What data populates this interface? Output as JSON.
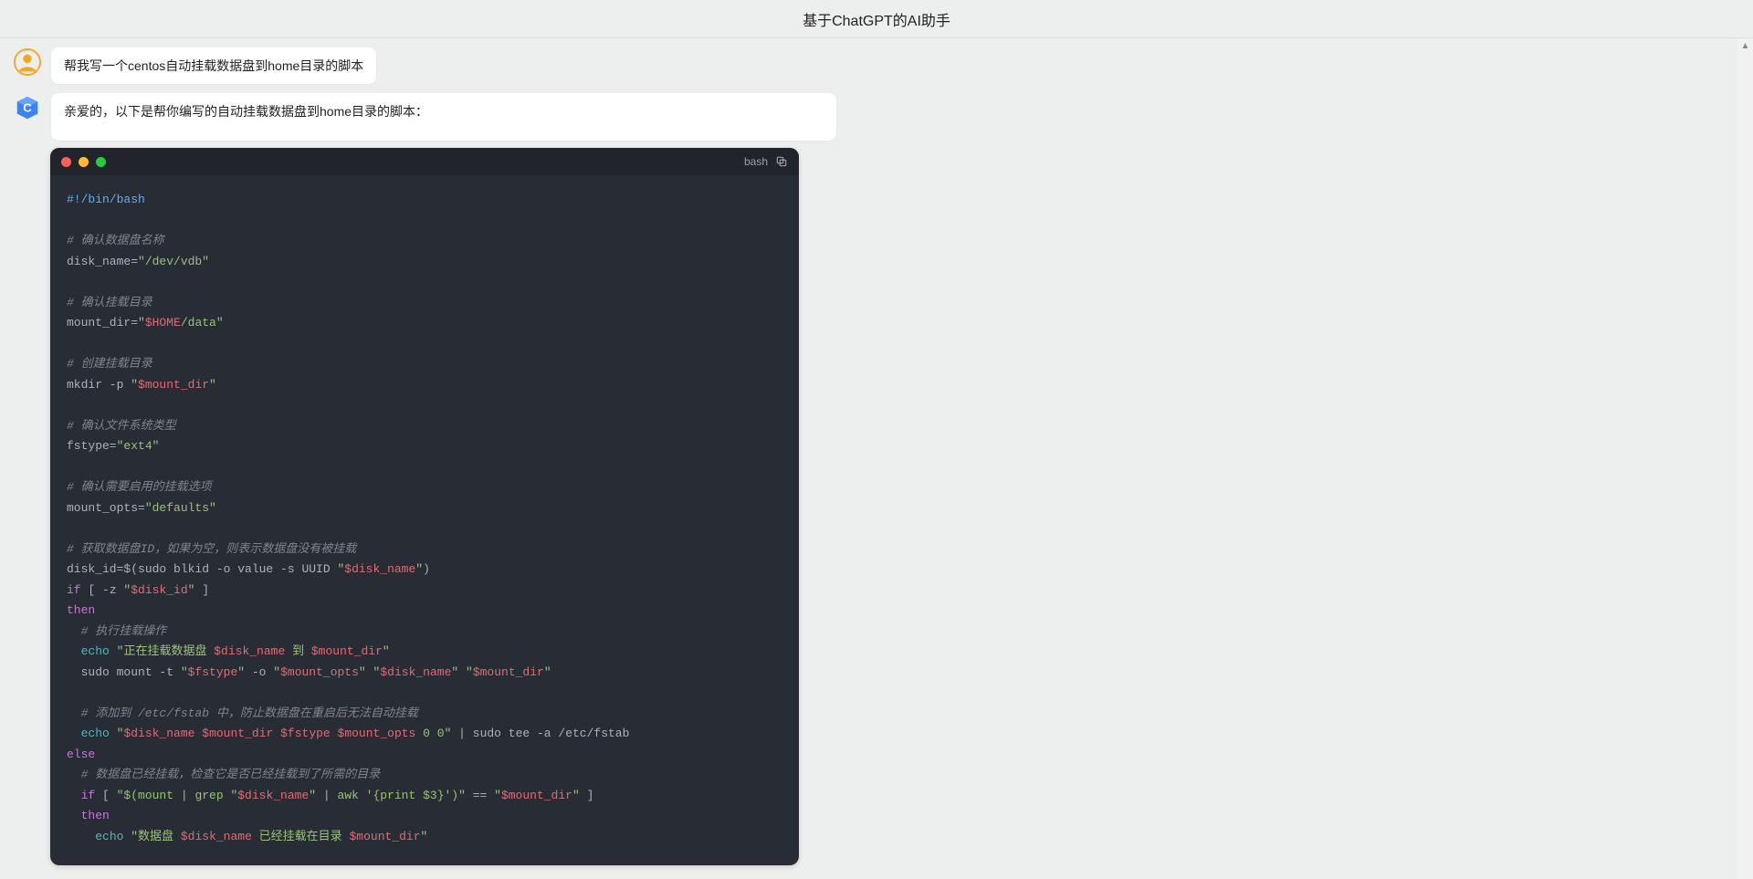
{
  "header": {
    "title": "基于ChatGPT的AI助手"
  },
  "conversation": {
    "user_message": "帮我写一个centos自动挂载数据盘到home目录的脚本",
    "bot_intro": "亲爱的，以下是帮你编写的自动挂载数据盘到home目录的脚本：",
    "code_language_label": "bash",
    "code": {
      "shebang": "#!/bin/bash",
      "c1": "# 确认数据盘名称",
      "l1a": "disk_name=",
      "l1b": "\"/dev/vdb\"",
      "c2": "# 确认挂载目录",
      "l2a": "mount_dir=",
      "l2b": "\"",
      "l2c": "$HOME",
      "l2d": "/data\"",
      "c3": "# 创建挂载目录",
      "l3a": "mkdir -p ",
      "l3b": "\"",
      "l3c": "$mount_dir",
      "l3d": "\"",
      "c4": "# 确认文件系统类型",
      "l4a": "fstype=",
      "l4b": "\"ext4\"",
      "c5": "# 确认需要启用的挂载选项",
      "l5a": "mount_opts=",
      "l5b": "\"defaults\"",
      "c6": "# 获取数据盘ID，如果为空，则表示数据盘没有被挂载",
      "l6a": "disk_id=$(sudo blkid -o value -s UUID ",
      "l6b": "\"",
      "l6c": "$disk_name",
      "l6d": "\"",
      "l6e": ")",
      "l7a": "if",
      "l7b": " [ -z ",
      "l7c": "\"",
      "l7d": "$disk_id",
      "l7e": "\"",
      "l7f": " ]",
      "l8": "then",
      "c7": "  # 执行挂载操作",
      "l9a": "  ",
      "l9b": "echo",
      "l9c": " ",
      "l9d": "\"正在挂载数据盘 ",
      "l9e": "$disk_name",
      "l9f": " 到 ",
      "l9g": "$mount_dir",
      "l9h": "\"",
      "l10a": "  sudo mount -t ",
      "l10b": "\"",
      "l10c": "$fstype",
      "l10d": "\"",
      "l10e": " -o ",
      "l10f": "\"",
      "l10g": "$mount_opts",
      "l10h": "\"",
      "l10i": " ",
      "l10j": "\"",
      "l10k": "$disk_name",
      "l10l": "\"",
      "l10m": " ",
      "l10n": "\"",
      "l10o": "$mount_dir",
      "l10p": "\"",
      "c8": "  # 添加到 /etc/fstab 中，防止数据盘在重启后无法自动挂载",
      "l11a": "  ",
      "l11b": "echo",
      "l11c": " ",
      "l11d": "\"",
      "l11e": "$disk_name",
      "l11f": " ",
      "l11g": "$mount_dir",
      "l11h": " ",
      "l11i": "$fstype",
      "l11j": " ",
      "l11k": "$mount_opts",
      "l11l": " 0 0\"",
      "l11m": " | sudo tee -a /etc/fstab",
      "l12": "else",
      "c9": "  # 数据盘已经挂载，检查它是否已经挂载到了所需的目录",
      "l13a": "  ",
      "l13b": "if",
      "l13c": " [ ",
      "l13d": "\"$(mount | grep \"",
      "l13e": "$disk_name",
      "l13f": "\" | awk '{print $3}')\"",
      "l13g": " == ",
      "l13h": "\"",
      "l13i": "$mount_dir",
      "l13j": "\"",
      "l13k": " ]",
      "l14a": "  ",
      "l14b": "then",
      "l15a": "    ",
      "l15b": "echo",
      "l15c": " ",
      "l15d": "\"数据盘 ",
      "l15e": "$disk_name",
      "l15f": " 已经挂载在目录 ",
      "l15g": "$mount_dir",
      "l15h": "\""
    }
  }
}
